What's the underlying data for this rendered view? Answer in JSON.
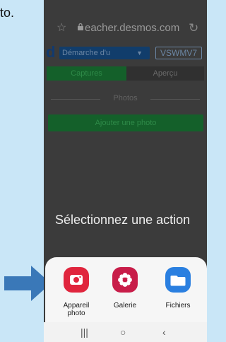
{
  "document": {
    "text_fragment": "to."
  },
  "browser": {
    "url": "eacher.desmos.com"
  },
  "app": {
    "logo": "d",
    "activity_select": "Démarche d'u",
    "code": "VSWMV7"
  },
  "tabs": [
    {
      "label": "Captures",
      "active": true
    },
    {
      "label": "Aperçu",
      "active": false
    }
  ],
  "photos_section": {
    "label": "Photos",
    "add_button": "Ajouter une photo"
  },
  "sheet": {
    "title": "Sélectionnez une action",
    "actions": [
      {
        "label": "Appareil photo",
        "icon": "camera-icon",
        "color": "#e0253d"
      },
      {
        "label": "Galerie",
        "icon": "flower-icon",
        "color": "#c81d49"
      },
      {
        "label": "Fichiers",
        "icon": "folder-icon",
        "color": "#2a7fe0"
      }
    ]
  },
  "colors": {
    "arrow": "#3a78b8",
    "primary_green": "#14602a",
    "app_blue": "#113d6b"
  }
}
